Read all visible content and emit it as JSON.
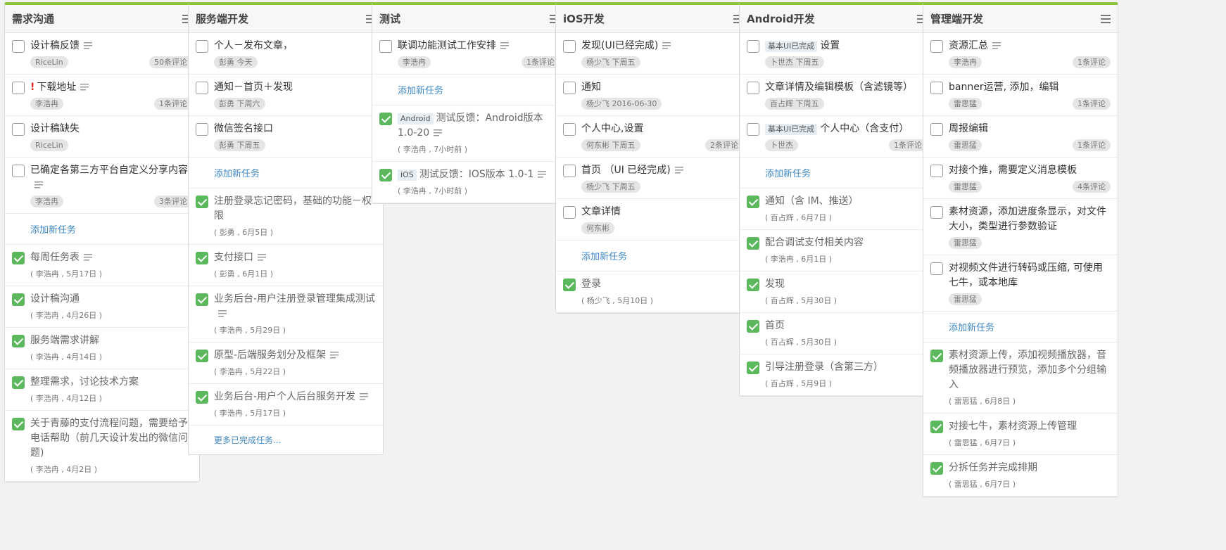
{
  "columns": [
    {
      "title": "需求沟通",
      "open": [
        {
          "title": "设计稿反馈",
          "note": true,
          "assignee": "RiceLin",
          "comments": "50条评论"
        },
        {
          "title": "下载地址",
          "note": true,
          "urgent": "!",
          "assignee": "李浩冉",
          "comments": "1条评论"
        },
        {
          "title": "设计稿缺失",
          "assignee": "RiceLin"
        },
        {
          "title": "已确定各第三方平台自定义分享内容",
          "note": true,
          "assignee": "李浩冉",
          "comments": "3条评论"
        }
      ],
      "add_label": "添加新任务",
      "done": [
        {
          "title": "每周任务表",
          "note": true,
          "meta": "( 李浩冉 , 5月17日 )"
        },
        {
          "title": "设计稿沟通",
          "meta": "( 李浩冉 , 4月26日 )"
        },
        {
          "title": "服务端需求讲解",
          "meta": "( 李浩冉 , 4月14日 )"
        },
        {
          "title": "整理需求，讨论技术方案",
          "meta": "( 李浩冉 , 4月12日 )"
        },
        {
          "title": "关于青藤的支付流程问题，需要给予电话帮助（前几天设计发出的微信问题)",
          "meta": "( 李浩冉 , 4月2日 )"
        }
      ]
    },
    {
      "title": "服务端开发",
      "open": [
        {
          "title": "个人－发布文章，",
          "assignee": "彭勇 今天"
        },
        {
          "title": "通知－首页＋发现",
          "assignee": "彭勇 下周六"
        },
        {
          "title": "微信签名接口",
          "assignee": "彭勇 下周五"
        }
      ],
      "add_label": "添加新任务",
      "done": [
        {
          "title": "注册登录忘记密码，基础的功能－权限",
          "meta": "( 彭勇 , 6月5日 )"
        },
        {
          "title": "支付接口",
          "note": true,
          "meta": "( 彭勇 , 6月1日 )"
        },
        {
          "title": "业务后台-用户注册登录管理集成测试",
          "note": true,
          "meta": "( 李浩冉 , 5月29日 )"
        },
        {
          "title": "原型-后端服务划分及框架",
          "note": true,
          "meta": "( 李浩冉 , 5月22日 )"
        },
        {
          "title": "业务后台-用户个人后台服务开发",
          "note": true,
          "meta": "( 李浩冉 , 5月17日 )"
        }
      ],
      "more_label": "更多已完成任务..."
    },
    {
      "title": "测试",
      "open": [
        {
          "title": "联调功能测试工作安排",
          "note": true,
          "assignee": "李浩冉",
          "comments": "1条评论"
        }
      ],
      "add_label": "添加新任务",
      "done": [
        {
          "tag": "Android",
          "title": "测试反馈：Android版本 1.0-20",
          "note": true,
          "meta": "( 李浩冉 , 7小时前 )"
        },
        {
          "tag": "iOS",
          "title": "测试反馈：IOS版本 1.0-1",
          "note": true,
          "meta": "( 李浩冉 , 7小时前 )"
        }
      ]
    },
    {
      "title": "iOS开发",
      "open": [
        {
          "title": "发现(UI已经完成)",
          "note": true,
          "assignee": "杨少飞 下周五"
        },
        {
          "title": "通知",
          "assignee": "杨少飞 2016-06-30"
        },
        {
          "title": "个人中心,设置",
          "assignee": "何东彬 下周五",
          "comments": "2条评论"
        },
        {
          "title": "首页 （UI 已经完成)",
          "note": true,
          "assignee": "杨少飞 下周五"
        },
        {
          "title": "文章详情",
          "assignee": "何东彬"
        }
      ],
      "add_label": "添加新任务",
      "done": [
        {
          "title": "登录",
          "meta": "( 杨少飞 , 5月10日 )"
        }
      ]
    },
    {
      "title": "Android开发",
      "open": [
        {
          "tag": "基本UI已完成",
          "title": "设置",
          "assignee": "卜世杰 下周五"
        },
        {
          "title": "文章详情及编辑模板（含滤镜等）",
          "assignee": "百占辉 下周五"
        },
        {
          "tag": "基本UI已完成",
          "title": "个人中心（含支付）",
          "assignee": "卜世杰",
          "comments": "1条评论"
        }
      ],
      "add_label": "添加新任务",
      "done": [
        {
          "title": "通知（含 IM、推送）",
          "meta": "( 百占辉 , 6月7日 )"
        },
        {
          "title": "配合调试支付相关内容",
          "meta": "( 李浩冉 , 6月1日 )"
        },
        {
          "title": "发现",
          "meta": "( 百占辉 , 5月30日 )"
        },
        {
          "title": "首页",
          "meta": "( 百占辉 , 5月30日 )"
        },
        {
          "title": "引导注册登录（含第三方）",
          "meta": "( 百占辉 , 5月9日 )"
        }
      ]
    },
    {
      "title": "管理端开发",
      "open": [
        {
          "title": "资源汇总",
          "note": true,
          "assignee": "李浩冉",
          "comments": "1条评论"
        },
        {
          "title": "banner运营, 添加，编辑",
          "assignee": "雷思猛",
          "comments": "1条评论"
        },
        {
          "title": "周报编辑",
          "assignee": "雷思猛",
          "comments": "1条评论"
        },
        {
          "title": "对接个推，需要定义消息模板",
          "assignee": "雷思猛",
          "comments": "4条评论"
        },
        {
          "title": "素材资源，添加进度条显示，对文件大小，类型进行参数验证",
          "assignee": "雷思猛"
        },
        {
          "title": "对视频文件进行转码或压缩, 可使用七牛，或本地库",
          "assignee": "雷思猛"
        }
      ],
      "add_label": "添加新任务",
      "done": [
        {
          "title": "素材资源上传，添加视频播放器，音频播放器进行预览，添加多个分组输入",
          "meta": "( 雷思猛 , 6月8日 )"
        },
        {
          "title": "对接七牛，素材资源上传管理",
          "meta": "( 雷思猛 , 6月7日 )"
        },
        {
          "title": "分拆任务并完成排期",
          "meta": "( 雷思猛 , 6月7日 )"
        }
      ]
    }
  ]
}
